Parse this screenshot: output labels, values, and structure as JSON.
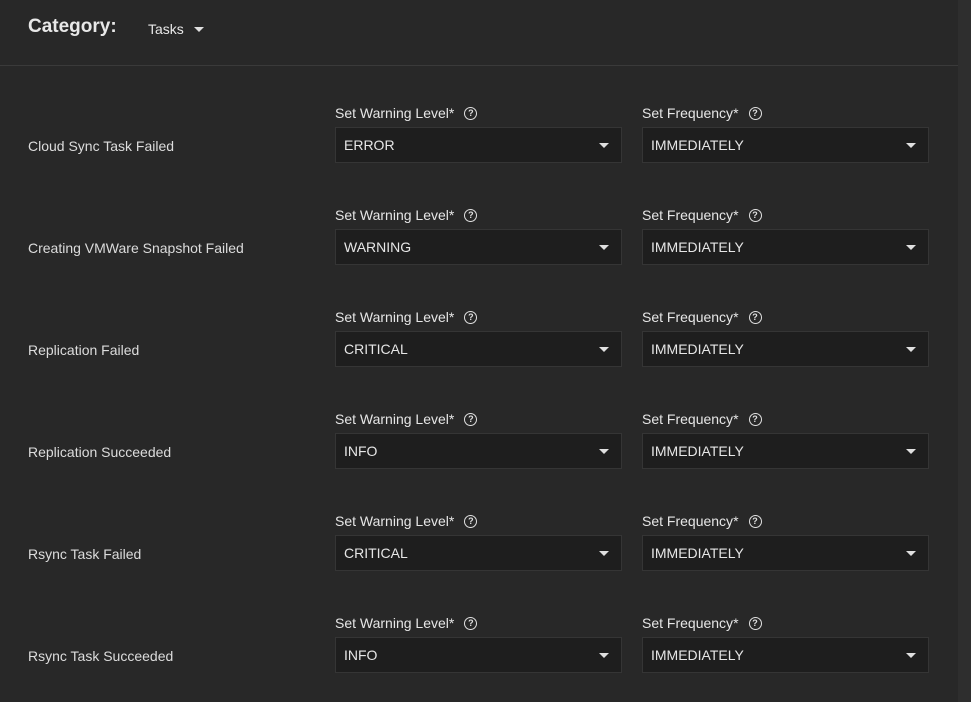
{
  "header": {
    "label": "Category:",
    "category_value": "Tasks"
  },
  "common": {
    "warning_level_label": "Set Warning Level",
    "frequency_label": "Set Frequency",
    "required_marker": "*",
    "help_glyph": "?"
  },
  "rows": [
    {
      "name": "Cloud Sync Task Failed",
      "level": "ERROR",
      "frequency": "IMMEDIATELY"
    },
    {
      "name": "Creating VMWare Snapshot Failed",
      "level": "WARNING",
      "frequency": "IMMEDIATELY"
    },
    {
      "name": "Replication Failed",
      "level": "CRITICAL",
      "frequency": "IMMEDIATELY"
    },
    {
      "name": "Replication Succeeded",
      "level": "INFO",
      "frequency": "IMMEDIATELY"
    },
    {
      "name": "Rsync Task Failed",
      "level": "CRITICAL",
      "frequency": "IMMEDIATELY"
    },
    {
      "name": "Rsync Task Succeeded",
      "level": "INFO",
      "frequency": "IMMEDIATELY"
    }
  ],
  "colors": {
    "background": "#282828",
    "field_background": "#1e1e1e",
    "text": "#e6e6e6"
  }
}
